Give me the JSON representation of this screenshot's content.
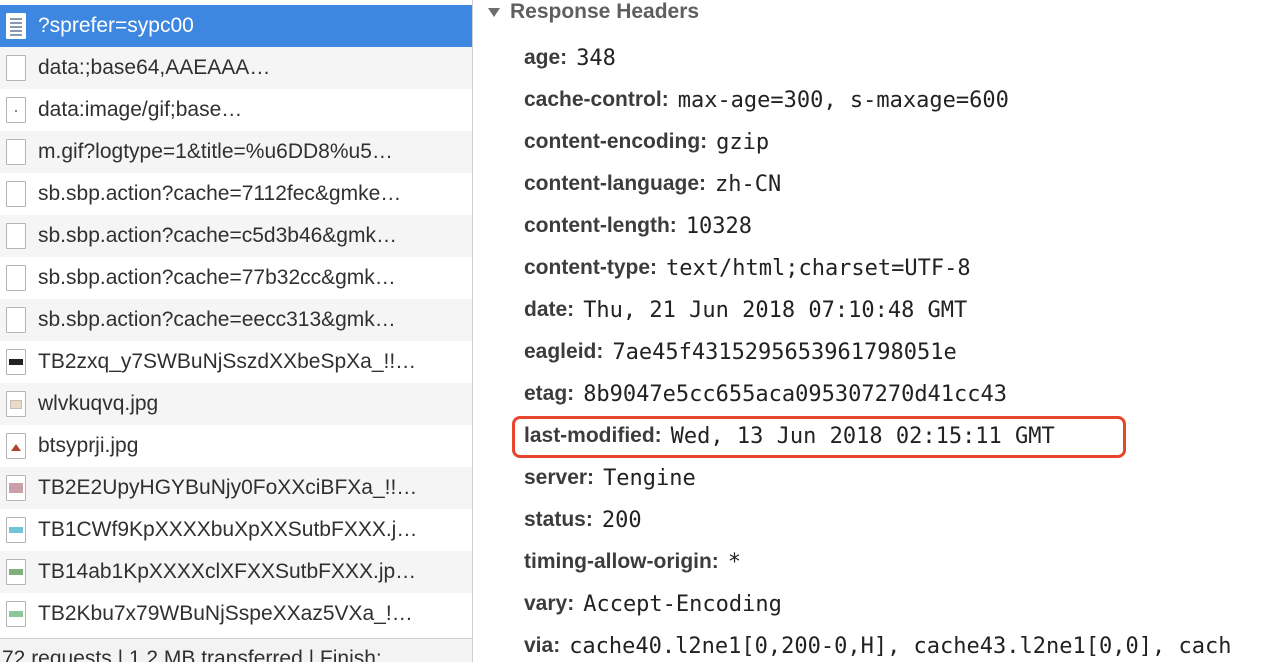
{
  "requests": [
    {
      "name": "?sprefer=sypc00",
      "icon": "document-icon",
      "selected": true
    },
    {
      "name": "data:;base64,AAEAAA…",
      "icon": "blank-file-icon"
    },
    {
      "name": "data:image/gif;base…",
      "icon": "gif-pixel-icon"
    },
    {
      "name": "m.gif?logtype=1&title=%u6DD8%u5…",
      "icon": "blank-file-icon"
    },
    {
      "name": "sb.sbp.action?cache=7112fec&gmke…",
      "icon": "blank-file-icon"
    },
    {
      "name": "sb.sbp.action?cache=c5d3b46&gmk…",
      "icon": "blank-file-icon"
    },
    {
      "name": "sb.sbp.action?cache=77b32cc&gmk…",
      "icon": "blank-file-icon"
    },
    {
      "name": "sb.sbp.action?cache=eecc313&gmk…",
      "icon": "blank-file-icon"
    },
    {
      "name": "TB2zxq_y7SWBuNjSszdXXbeSpXa_!!…",
      "icon": "image-thumbnail-icon"
    },
    {
      "name": "wlvkuqvq.jpg",
      "icon": "image-thumbnail-icon"
    },
    {
      "name": "btsyprji.jpg",
      "icon": "image-thumbnail-icon"
    },
    {
      "name": "TB2E2UpyHGYBuNjy0FoXXciBFXa_!!…",
      "icon": "image-thumbnail-icon"
    },
    {
      "name": "TB1CWf9KpXXXXbuXpXXSutbFXXX.j…",
      "icon": "image-thumbnail-icon"
    },
    {
      "name": "TB14ab1KpXXXXclXFXXSutbFXXX.jp…",
      "icon": "image-thumbnail-icon"
    },
    {
      "name": "TB2Kbu7x79WBuNjSspeXXaz5VXa_!…",
      "icon": "image-thumbnail-icon"
    }
  ],
  "summary": "72 requests | 1.2 MB transferred | Finish:",
  "section": {
    "title": "Response Headers",
    "icon": "collapse-triangle-icon"
  },
  "headers": [
    {
      "key": "age:",
      "value": "348"
    },
    {
      "key": "cache-control:",
      "value": "max-age=300, s-maxage=600"
    },
    {
      "key": "content-encoding:",
      "value": "gzip"
    },
    {
      "key": "content-language:",
      "value": "zh-CN"
    },
    {
      "key": "content-length:",
      "value": "10328"
    },
    {
      "key": "content-type:",
      "value": "text/html;charset=UTF-8"
    },
    {
      "key": "date:",
      "value": "Thu, 21 Jun 2018 07:10:48 GMT"
    },
    {
      "key": "eagleid:",
      "value": "7ae45f4315295653961798051e"
    },
    {
      "key": "etag:",
      "value": "8b9047e5cc655aca095307270d41cc43"
    },
    {
      "key": "last-modified:",
      "value": "Wed, 13 Jun 2018 02:15:11 GMT",
      "highlighted": true
    },
    {
      "key": "server:",
      "value": "Tengine"
    },
    {
      "key": "status:",
      "value": "200"
    },
    {
      "key": "timing-allow-origin:",
      "value": "*"
    },
    {
      "key": "vary:",
      "value": "Accept-Encoding"
    },
    {
      "key": "via:",
      "value": "cache40.l2ne1[0,200-0,H], cache43.l2ne1[0,0], cach"
    }
  ],
  "colors": {
    "selection": "#3d87e0",
    "highlight_border": "#e8462c"
  }
}
